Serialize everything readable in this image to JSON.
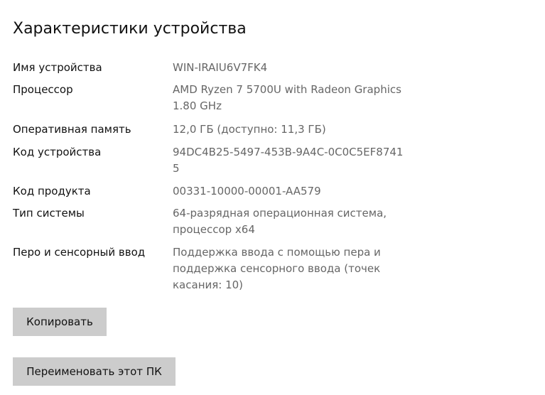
{
  "header": {
    "title": "Характеристики устройства"
  },
  "specs": [
    {
      "label": "Имя устройства",
      "value_lines": [
        "WIN-IRAIU6V7FK4"
      ]
    },
    {
      "label": "Процессор",
      "value_lines": [
        "AMD Ryzen 7 5700U with Radeon Graphics",
        "1.80 GHz"
      ]
    },
    {
      "label": "Оперативная память",
      "value_lines": [
        "12,0 ГБ (доступно: 11,3 ГБ)"
      ]
    },
    {
      "label": "Код устройства",
      "value_lines": [
        "94DC4B25-5497-453B-9A4C-0C0C5EF8741",
        "5"
      ]
    },
    {
      "label": "Код продукта",
      "value_lines": [
        "00331-10000-00001-AA579"
      ]
    },
    {
      "label": "Тип системы",
      "value_lines": [
        "64-разрядная операционная система,",
        "процессор x64"
      ]
    },
    {
      "label": "Перо и сенсорный ввод",
      "value_lines": [
        "Поддержка ввода с помощью пера и",
        "поддержка сенсорного ввода (точек",
        "касания: 10)"
      ]
    }
  ],
  "actions": {
    "copy_label": "Копировать",
    "rename_label": "Переименовать этот ПК"
  },
  "colors": {
    "label_text": "#111111",
    "value_text": "#666666",
    "button_bg": "#cccccc"
  }
}
